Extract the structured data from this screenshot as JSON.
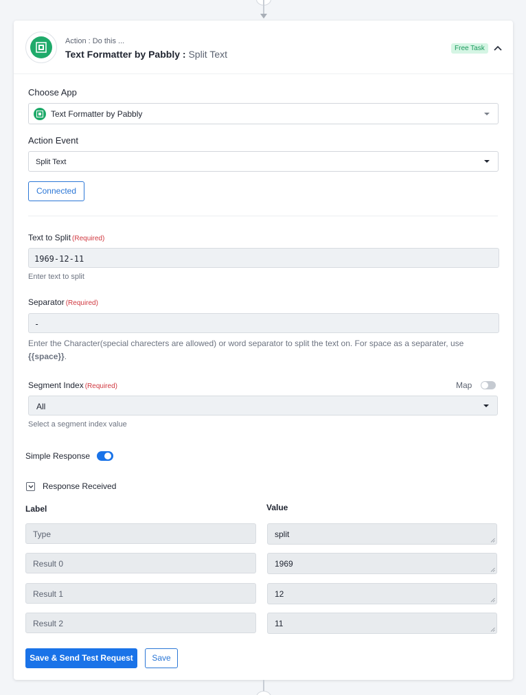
{
  "header": {
    "subtitle": "Action : Do this ...",
    "app_name": "Text Formatter by Pabbly :",
    "event_name": "Split Text",
    "badge": "Free Task"
  },
  "choose_app": {
    "label": "Choose App",
    "value": "Text Formatter by Pabbly"
  },
  "action_event": {
    "label": "Action Event",
    "value": "Split Text"
  },
  "connected_label": "Connected",
  "required_tag": "(Required)",
  "text_to_split": {
    "label": "Text to Split",
    "value": "1969-12-11",
    "help": "Enter text to split"
  },
  "separator": {
    "label": "Separator",
    "value": "-",
    "help_prefix": "Enter the Character(special charecters are allowed) or word separator to split the text on. For space as a separater, use",
    "help_token": "{{space}}",
    "help_suffix": "."
  },
  "segment_index": {
    "label": "Segment Index",
    "map_label": "Map",
    "map_enabled": false,
    "value": "All",
    "help": "Select a segment index value"
  },
  "simple_response": {
    "label": "Simple Response",
    "enabled": true
  },
  "response_received": {
    "label": "Response Received",
    "columns": {
      "label": "Label",
      "value": "Value"
    },
    "rows": [
      {
        "label": "Type",
        "value": "split"
      },
      {
        "label": "Result 0",
        "value": "1969"
      },
      {
        "label": "Result 1",
        "value": "12"
      },
      {
        "label": "Result 2",
        "value": "11"
      }
    ]
  },
  "buttons": {
    "save_send": "Save & Send Test Request",
    "save": "Save"
  },
  "colors": {
    "accent": "#1a73e8",
    "brand_green": "#1faa6a",
    "required": "#d0373f",
    "badge_bg": "#d5f5e4"
  },
  "icons": {
    "app_logo": "text-formatter-icon",
    "collapse": "chevron-up-icon",
    "dropdown": "caret-down-icon",
    "expand": "chevron-down-icon"
  }
}
